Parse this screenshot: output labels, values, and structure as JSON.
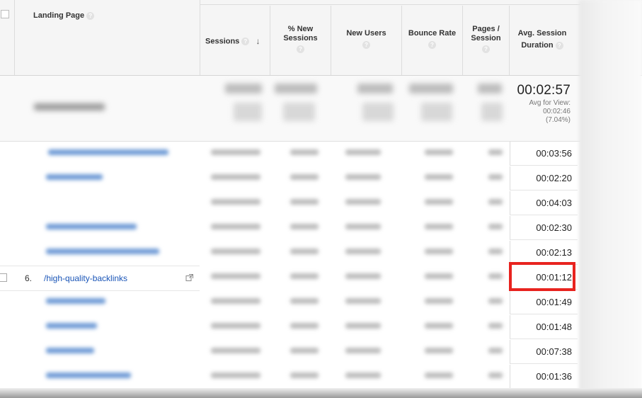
{
  "table": {
    "headers": {
      "landing_page": "Landing Page",
      "sessions": "Sessions",
      "pct_new_sessions_l1": "% New",
      "pct_new_sessions_l2": "Sessions",
      "new_users": "New Users",
      "bounce_rate": "Bounce Rate",
      "pages_session_l1": "Pages /",
      "pages_session_l2": "Session",
      "avg_session_duration_l1": "Avg. Session",
      "avg_session_duration_l2": "Duration",
      "help_glyph": "?",
      "sort_glyph": "↓"
    },
    "summary": {
      "avg_session_duration": "00:02:57",
      "avg_for_view_label": "Avg for View:",
      "avg_for_view_value": "00:02:46",
      "avg_for_view_pct": "(7.04%)"
    },
    "durations": [
      "00:03:56",
      "00:02:20",
      "00:04:03",
      "00:02:30",
      "00:02:13",
      "00:01:12",
      "00:01:49",
      "00:01:48",
      "00:07:38",
      "00:01:36"
    ],
    "highlighted_row": {
      "index": "6.",
      "landing_page": "/high-quality-backlinks"
    }
  },
  "colors": {
    "highlight": "#e8231f",
    "link": "#1a55b7"
  }
}
